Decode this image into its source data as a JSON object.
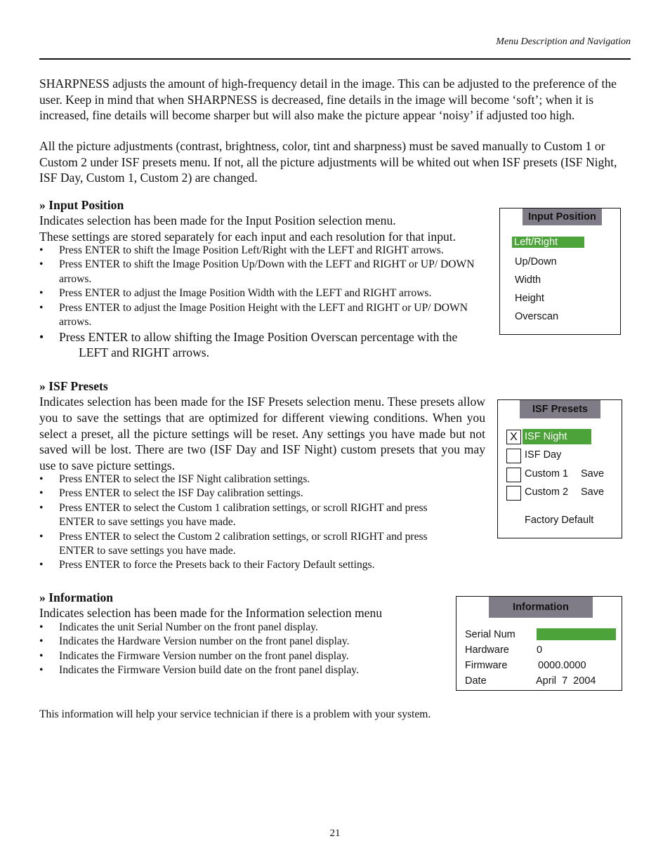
{
  "header": {
    "title": "Menu Description and Navigation"
  },
  "intro": {
    "paragraph1": "SHARPNESS adjusts the amount of high-frequency detail in the image. This can be adjusted to the   preference of the user. Keep in mind that when SHARPNESS is decreased, fine details in the image will become ‘soft’; when it is increased, fine details will become sharper but will also make the picture appear ‘noisy’ if adjusted too high.",
    "paragraph2": "All the picture adjustments (contrast, brightness, color, tint and sharpness) must be saved manually to Custom 1 or Custom 2 under ISF presets menu. If not, all the picture adjustments will be whited out when ISF presets (ISF Night, ISF Day, Custom 1, Custom 2) are changed."
  },
  "input_position": {
    "heading": "» Input Position",
    "line1": "Indicates selection has been made for the Input Position selection menu.",
    "line2": "These settings are stored separately for each input and each resolution for that input.",
    "bullets": [
      "Press ENTER to shift the Image Position Left/Right with the LEFT and RIGHT arrows.",
      "Press ENTER to shift the Image Position Up/Down with the LEFT and RIGHT or UP/ DOWN arrows.",
      "Press ENTER to adjust the Image Position Width with the LEFT and RIGHT arrows.",
      "Press ENTER to adjust the Image Position Height with the LEFT and RIGHT or UP/ DOWN arrows.",
      "Press ENTER to allow shifting the Image Position Overscan percentage with the",
      "LEFT and RIGHT arrows."
    ],
    "menu": {
      "title": "Input Position",
      "items": [
        "Left/Right",
        "Up/Down",
        "Width",
        "Height",
        "Overscan"
      ],
      "selected": "Left/Right"
    }
  },
  "isf_presets": {
    "heading": "» ISF Presets",
    "text": "Indicates selection has been made for the ISF Presets selection menu. These presets allow you to save the settings that are optimized for different viewing conditions. When you select a preset, all the picture settings will be reset. Any settings you have made but not saved will be lost. There are two (ISF Day and ISF Night) custom presets that you may use to save picture settings.",
    "bullets": [
      "Press ENTER to select the ISF Night calibration settings.",
      "Press ENTER to select the ISF Day calibration settings.",
      "Press ENTER to select the Custom 1 calibration settings, or scroll RIGHT and press ENTER to save settings you have made.",
      "Press ENTER to select the Custom 2 calibration settings, or scroll RIGHT and press ENTER to save settings you have made.",
      "Press ENTER to force the Presets back to their Factory Default settings."
    ],
    "menu": {
      "title": "ISF Presets",
      "items": [
        {
          "label": "ISF Night",
          "checked": "X"
        },
        {
          "label": "ISF Day",
          "checked": ""
        },
        {
          "label": "Custom 1",
          "checked": "",
          "action": "Save"
        },
        {
          "label": "Custom 2",
          "checked": "",
          "action": "Save"
        }
      ],
      "factory_default": "Factory Default",
      "selected": "ISF Night"
    }
  },
  "information": {
    "heading": "» Information",
    "text": "Indicates selection has been made for the Information selection menu",
    "bullets": [
      "Indicates the unit Serial Number on the front panel display.",
      "Indicates the Hardware Version number on the front panel display.",
      "Indicates the Firmware Version number on the front panel display.",
      "Indicates the Firmware Version build date on the front panel display."
    ],
    "menu": {
      "title": "Information",
      "rows": [
        {
          "label": "Serial Num",
          "value": ""
        },
        {
          "label": "Hardware",
          "value": "0"
        },
        {
          "label": "Firmware",
          "value": "0000.0000"
        },
        {
          "label": "Date",
          "value": "April  7  2004"
        }
      ]
    }
  },
  "closing": "This information will help your service technician if there is a problem with your system.",
  "page_number": "21",
  "colors": {
    "selection_green": "#4ca33a",
    "menu_title_gray": "#7f7c87"
  }
}
